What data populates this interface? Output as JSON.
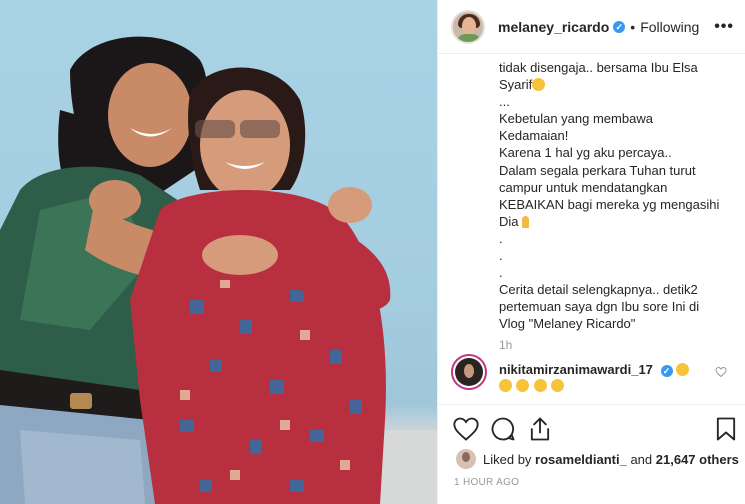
{
  "header": {
    "username": "melaney_ricardo",
    "verified_mark": "✓",
    "separator": "•",
    "follow_status": "Following",
    "more_label": "•••"
  },
  "caption": {
    "lines": [
      "tidak disengaja.. bersama Ibu Elsa",
      "Syarif",
      "...",
      "Kebetulan yang membawa",
      "Kedamaian!",
      "Karena 1 hal yg aku percaya..",
      "Dalam segala perkara Tuhan turut",
      "campur untuk mendatangkan",
      "KEBAIKAN bagi mereka yg mengasihi",
      "Dia",
      ".",
      ".",
      ".",
      "Cerita detail selengkapnya.. detik2",
      "pertemuan saya dgn Ibu sore Ini di",
      "Vlog \"Melaney Ricardo\""
    ],
    "timestamp": "1h"
  },
  "comment": {
    "username": "nikitamirzanimawardi_17",
    "emoji_count": 4
  },
  "likes": {
    "prefix": "Liked by",
    "user": "rosameldianti_",
    "middle": "and",
    "count": "21,647 others"
  },
  "post_time": "1 HOUR AGO",
  "icons": [
    "more-icon",
    "heart-icon",
    "comment-icon",
    "share-icon",
    "bookmark-icon",
    "verified-icon"
  ],
  "colors": {
    "verified": "#3897f0",
    "text": "#262626",
    "muted": "#999999",
    "border": "#efefef"
  }
}
